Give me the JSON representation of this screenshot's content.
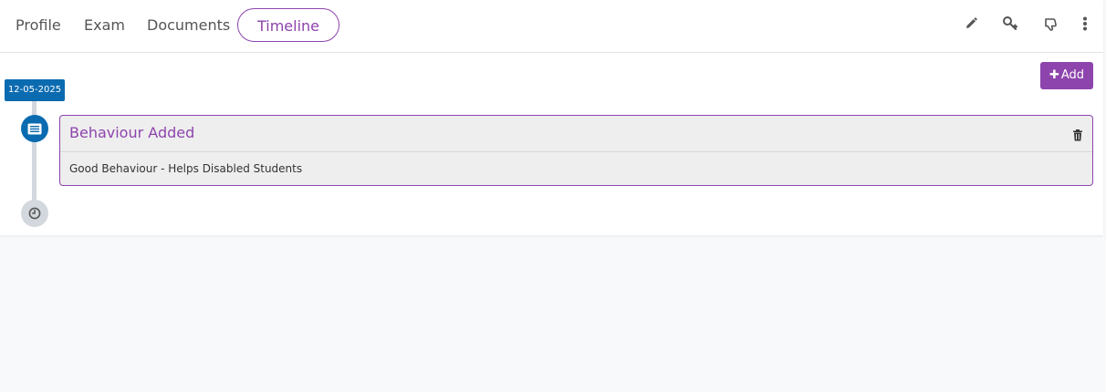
{
  "tabs": [
    {
      "label": "Profile",
      "active": false
    },
    {
      "label": "Exam",
      "active": false
    },
    {
      "label": "Documents",
      "active": false
    },
    {
      "label": "Timeline",
      "active": true
    }
  ],
  "toolbar_icons": [
    "pencil-icon",
    "key-icon",
    "thumbs-down-icon",
    "more-vertical-icon"
  ],
  "add_button": {
    "label": "Add",
    "icon": "plus-icon"
  },
  "timeline": {
    "date": "12-05-2025",
    "entries": [
      {
        "icon": "list-icon",
        "title": "Behaviour Added",
        "description": "Good Behaviour - Helps Disabled Students",
        "action_icon": "trash-icon"
      }
    ],
    "end_icon": "clock-icon"
  },
  "colors": {
    "accent": "#8e44ad",
    "date_badge": "#0b6bb0",
    "timeline_line": "#d3d8de",
    "page_bg": "#f8f9fb"
  }
}
